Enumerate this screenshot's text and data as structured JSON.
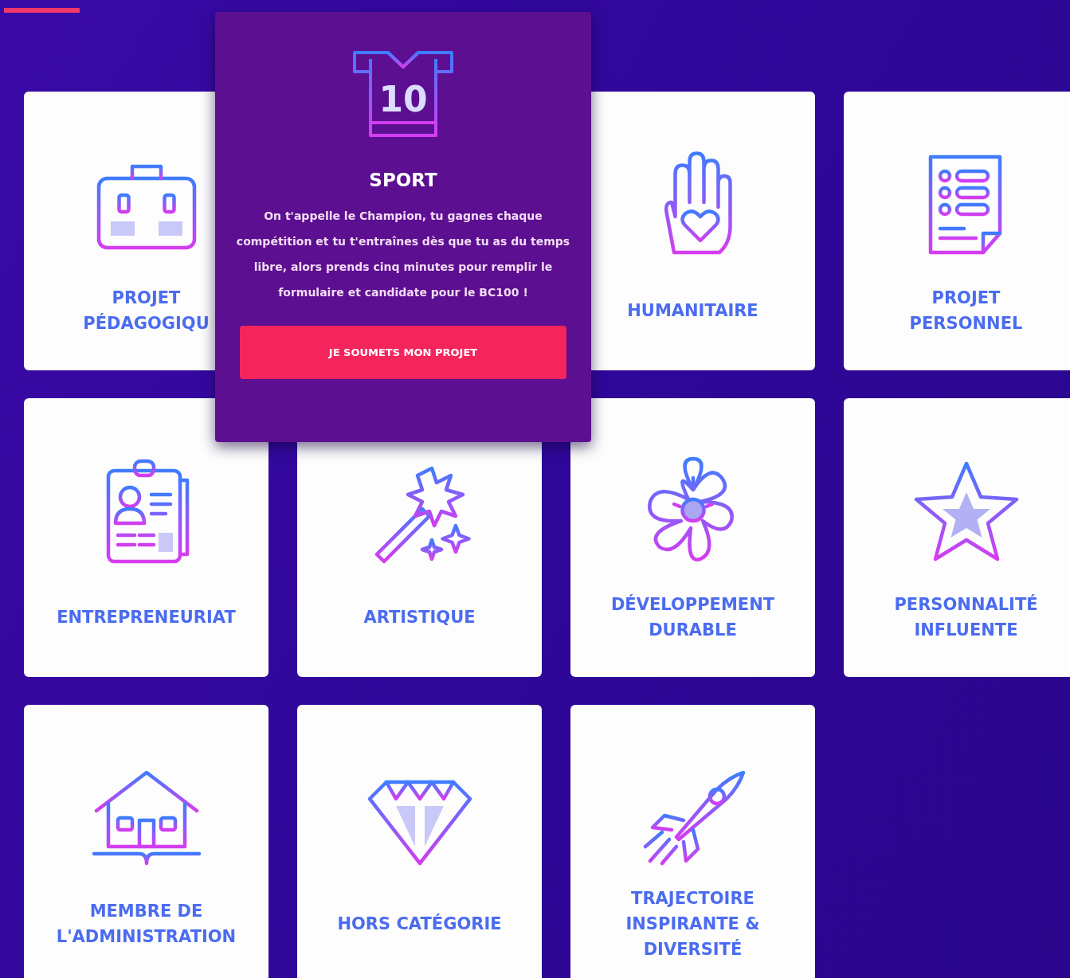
{
  "categories": [
    {
      "kind": "card",
      "label_lines": [
        "PROJET",
        "PÉDAGOGIQU"
      ]
    },
    {
      "kind": "popup",
      "jersey_number": "10",
      "title": "SPORT",
      "text": "On t'appelle le Champion, tu gagnes chaque compétition et tu t'entraînes dès que tu as du temps libre, alors prends cinq minutes pour remplir le formulaire et candidate pour le BC100 !",
      "button": "JE SOUMETS MON PROJET"
    },
    {
      "kind": "card",
      "label_lines": [
        "HUMANITAIRE"
      ]
    },
    {
      "kind": "card",
      "label_lines": [
        "PROJET",
        "PERSONNEL"
      ]
    },
    {
      "kind": "card",
      "label_lines": [
        "ENTREPRENEURIAT"
      ]
    },
    {
      "kind": "card",
      "label_lines": [
        "ARTISTIQUE"
      ]
    },
    {
      "kind": "card",
      "label_lines": [
        "DÉVELOPPEMENT",
        "DURABLE"
      ]
    },
    {
      "kind": "card",
      "label_lines": [
        "PERSONNALITÉ",
        "INFLUENTE"
      ]
    },
    {
      "kind": "card",
      "label_lines": [
        "MEMBRE DE",
        "L'ADMINISTRATION"
      ]
    },
    {
      "kind": "card",
      "label_lines": [
        "HORS CATÉGORIE"
      ]
    },
    {
      "kind": "card",
      "label_lines": [
        "TRAJECTOIRE",
        "INSPIRANTE &",
        "DIVERSITÉ"
      ]
    }
  ]
}
